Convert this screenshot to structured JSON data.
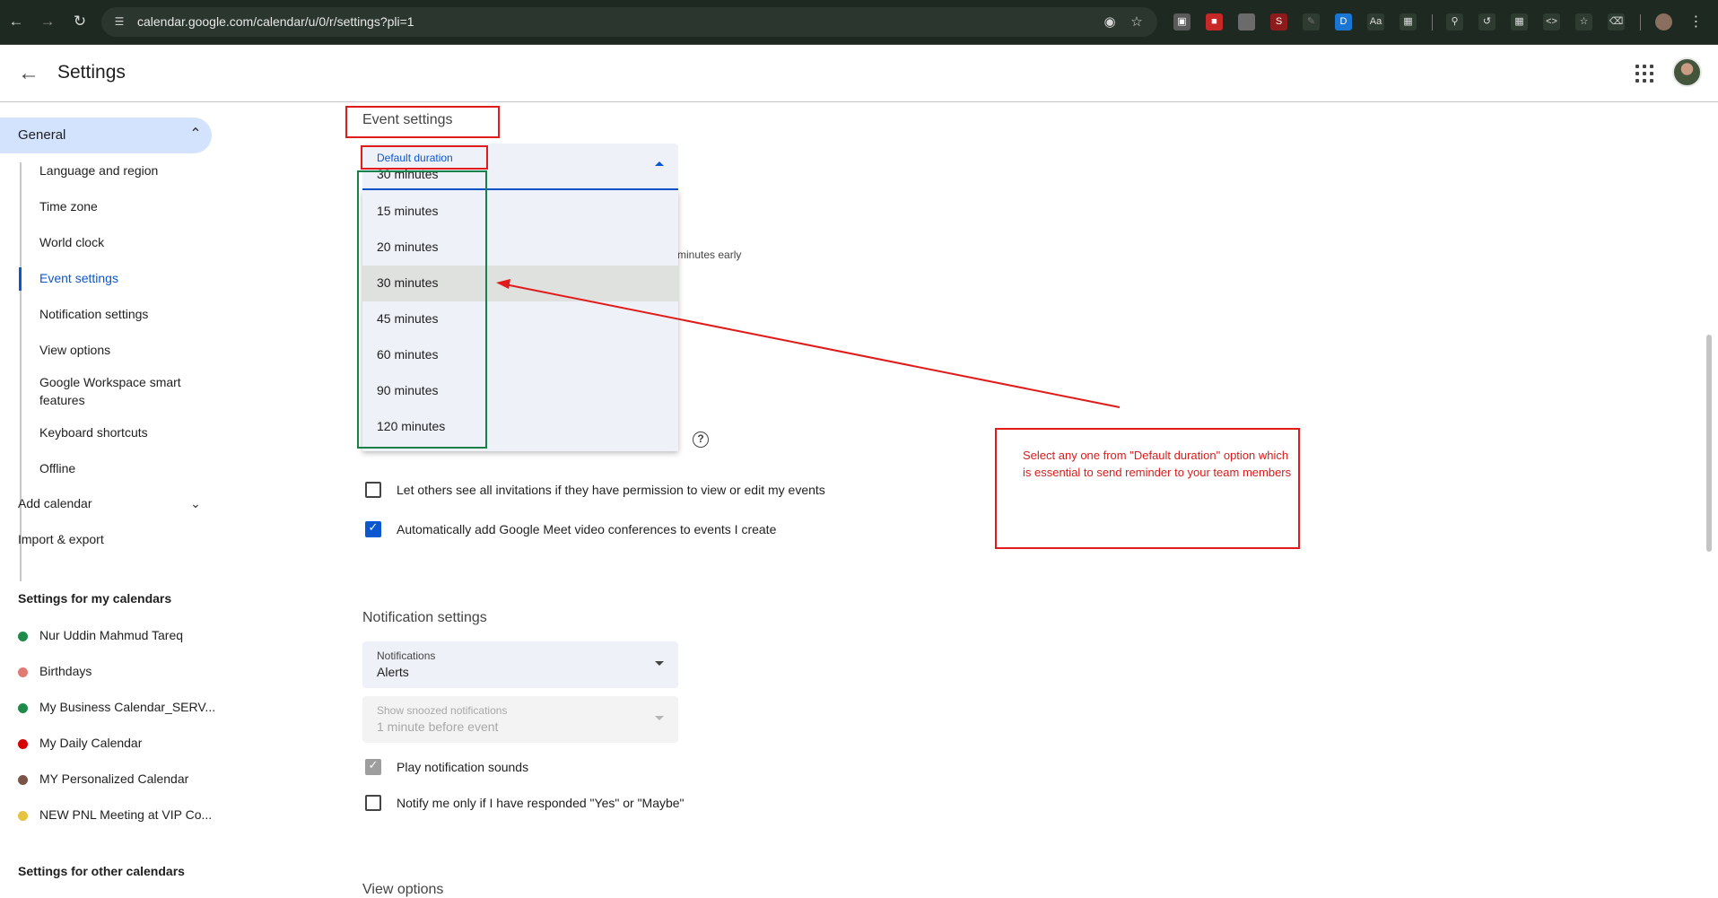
{
  "browser": {
    "url": "calendar.google.com/calendar/u/0/r/settings?pli=1",
    "icons": [
      "back-icon",
      "forward-icon",
      "reload-icon",
      "site-info-icon",
      "eye-icon",
      "star-icon"
    ]
  },
  "header": {
    "title": "Settings"
  },
  "sidebar": {
    "general_label": "General",
    "sub_items": [
      {
        "label": "Language and region"
      },
      {
        "label": "Time zone"
      },
      {
        "label": "World clock"
      },
      {
        "label": "Event settings"
      },
      {
        "label": "Notification settings"
      },
      {
        "label": "View options"
      },
      {
        "label": "Google Workspace smart features"
      },
      {
        "label": "Keyboard shortcuts"
      },
      {
        "label": "Offline"
      }
    ],
    "add_calendar": "Add calendar",
    "import_export": "Import & export",
    "my_calendars_title": "Settings for my calendars",
    "my_calendars": [
      {
        "label": "Nur Uddin Mahmud Tareq",
        "color": "#1f8a4c"
      },
      {
        "label": "Birthdays",
        "color": "#e07b73"
      },
      {
        "label": "My Business Calendar_SERV...",
        "color": "#1f8a4c"
      },
      {
        "label": "My Daily Calendar",
        "color": "#d50000"
      },
      {
        "label": "MY Personalized Calendar",
        "color": "#795548"
      },
      {
        "label": "NEW PNL Meeting at VIP Co...",
        "color": "#e4c441"
      }
    ],
    "other_calendars_title": "Settings for other calendars"
  },
  "event_settings": {
    "title": "Event settings",
    "default_duration": {
      "label": "Default duration",
      "value": "30 minutes",
      "options": [
        "15 minutes",
        "20 minutes",
        "30 minutes",
        "45 minutes",
        "60 minutes",
        "90 minutes",
        "120 minutes"
      ],
      "selected": "30 minutes"
    },
    "partial_hidden_text": "minutes early",
    "checkbox_invitations": {
      "label": "Let others see all invitations if they have permission to view or edit my events",
      "checked": false
    },
    "checkbox_meet": {
      "label": "Automatically add Google Meet video conferences to events I create",
      "checked": true
    }
  },
  "notification_settings": {
    "title": "Notification settings",
    "notifications": {
      "label": "Notifications",
      "value": "Alerts"
    },
    "snoozed": {
      "label": "Show snoozed notifications",
      "value": "1 minute before event",
      "disabled": true
    },
    "checkbox_sounds": {
      "label": "Play notification sounds",
      "checked": true,
      "disabled": true
    },
    "checkbox_responded": {
      "label": "Notify me only if I have responded \"Yes\" or \"Maybe\"",
      "checked": false
    }
  },
  "cut_section_title": "View options",
  "annotation": {
    "text": "Select any one from \"Default duration\" option which is essential to send reminder to your team members",
    "color": "#d91c1c"
  },
  "colors": {
    "accent": "#0b57d0",
    "nav_active_bg": "#d3e3fd",
    "annotation_red": "#e01b1b",
    "annotation_green": "#18804a"
  }
}
